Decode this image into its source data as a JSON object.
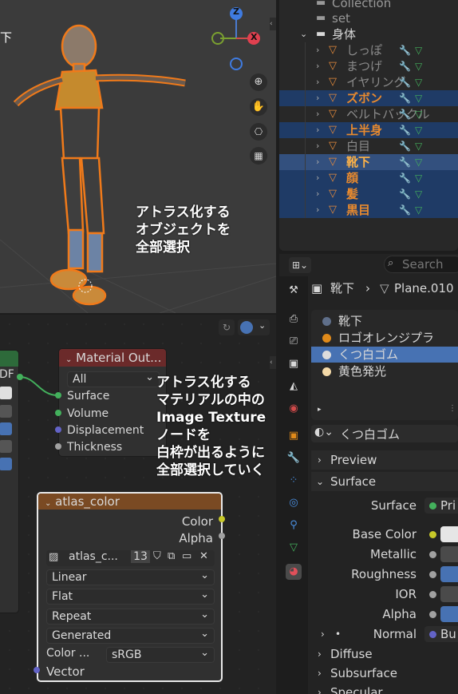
{
  "viewport": {
    "top_left_label": "下",
    "annotation": "アトラス化する\nオブジェクトを\n全部選択",
    "gizmo": {
      "z": "Z",
      "x": "X"
    }
  },
  "outliner": {
    "collection": "Collection",
    "set": "set",
    "parent": "身体",
    "items": [
      {
        "label": "しっぽ",
        "state": "normal"
      },
      {
        "label": "まつげ",
        "state": "normal"
      },
      {
        "label": "イヤリング",
        "state": "normal"
      },
      {
        "label": "ズボン",
        "state": "selected"
      },
      {
        "label": "ベルトバックル",
        "state": "normal"
      },
      {
        "label": "上半身",
        "state": "selected"
      },
      {
        "label": "白目",
        "state": "normal"
      },
      {
        "label": "靴下",
        "state": "active"
      },
      {
        "label": "顔",
        "state": "selected"
      },
      {
        "label": "髪",
        "state": "selected"
      },
      {
        "label": "黒目",
        "state": "selected"
      }
    ]
  },
  "node_editor": {
    "material_output": {
      "title": "Material Out...",
      "target": "All",
      "inputs": [
        "Surface",
        "Volume",
        "Displacement",
        "Thickness"
      ]
    },
    "bsdf_output_label": "DF",
    "annotation": "アトラス化する\nマテリアルの中の\nImage Texture\nノードを\n白枠が出るように\n全部選択していく",
    "image_node": {
      "title": "atlas_color",
      "outputs": [
        "Color",
        "Alpha"
      ],
      "image_name": "atlas_c...",
      "users": "13",
      "interpolation": "Linear",
      "projection": "Flat",
      "extension": "Repeat",
      "source": "Generated",
      "color_space_label": "Color ...",
      "color_space": "sRGB",
      "vector_label": "Vector"
    }
  },
  "properties": {
    "search_placeholder": "Search",
    "breadcrumb_object": "靴下",
    "breadcrumb_mesh": "Plane.010",
    "materials": [
      {
        "label": "靴下",
        "color": "#5f6f8a"
      },
      {
        "label": "ロゴオレンジプラ",
        "color": "#e08a1a"
      },
      {
        "label": "くつ白ゴム",
        "color": "#dcdcdc"
      },
      {
        "label": "黄色発光",
        "color": "#f3d9a8"
      }
    ],
    "active_material": "くつ白ゴム",
    "preview_label": "Preview",
    "surface_label": "Surface",
    "surface_field_label": "Surface",
    "surface_value": "Pri",
    "inputs": [
      {
        "label": "Base Color",
        "color": "#e6e6e6",
        "dot": "#c7c829"
      },
      {
        "label": "Metallic",
        "color": "#4a4a4a",
        "dot": "#a1a1a1"
      },
      {
        "label": "Roughness",
        "color": "#4772b3",
        "dot": "#a1a1a1"
      },
      {
        "label": "IOR",
        "color": "#4a4a4a",
        "dot": "#a1a1a1"
      },
      {
        "label": "Alpha",
        "color": "#4772b3",
        "dot": "#a1a1a1"
      }
    ],
    "normal_label": "Normal",
    "normal_value": "Bu",
    "subpanels": [
      "Diffuse",
      "Subsurface",
      "Specular"
    ]
  }
}
